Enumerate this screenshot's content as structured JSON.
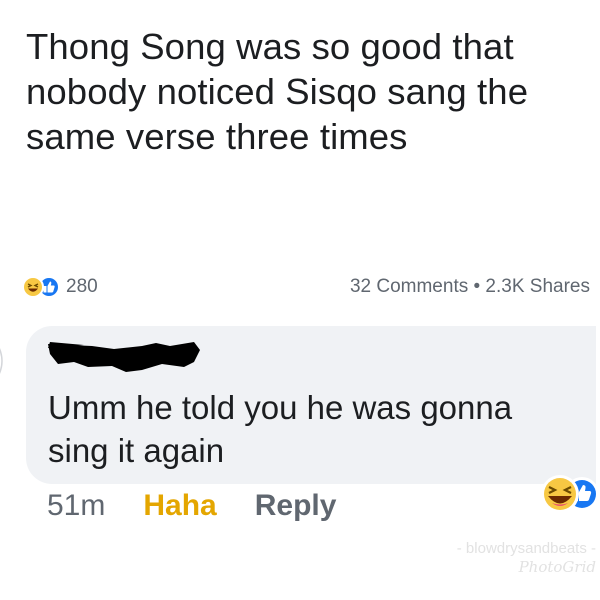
{
  "post": {
    "text": "Thong Song was so good that nobody noticed Sisqo sang the same verse three times"
  },
  "stats": {
    "reaction_icons": [
      "haha-icon",
      "like-icon"
    ],
    "reaction_count": "280",
    "comments_shares": "32 Comments • 2.3K Shares"
  },
  "comment": {
    "text": "Umm he told you he was gonna sing it again",
    "timestamp": "51m",
    "haha_label": "Haha",
    "reply_label": "Reply",
    "reaction_icons": [
      "haha-icon",
      "like-icon"
    ]
  },
  "watermark": {
    "line1": "- blowdrysandbeats -",
    "line2": "PhotoGrid"
  },
  "colors": {
    "text": "#1c1e21",
    "muted": "#606770",
    "haha_accent": "#e4a600",
    "bubble_bg": "#f0f2f5",
    "like_blue": "#1877f2",
    "haha_yellow": "#f7c843"
  }
}
